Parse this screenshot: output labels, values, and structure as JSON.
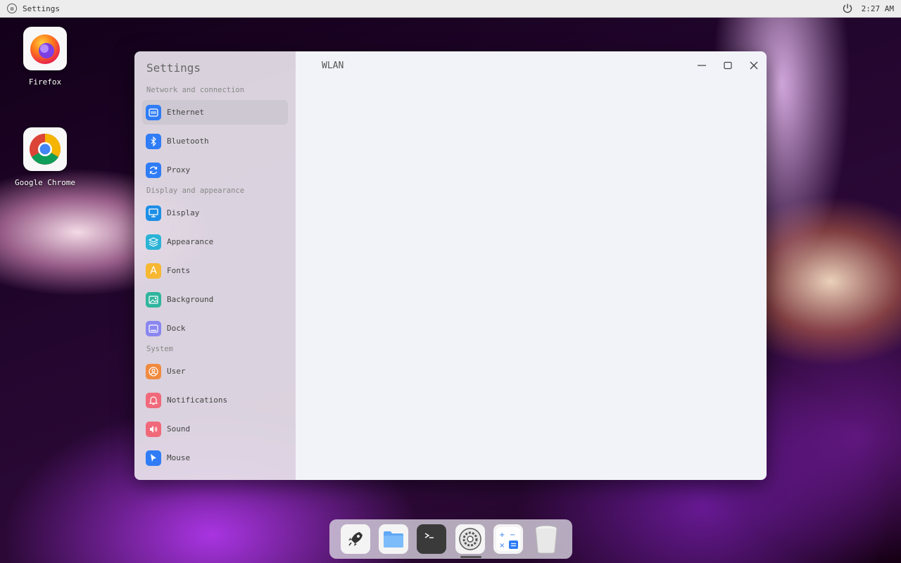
{
  "topbar": {
    "app_title": "Settings",
    "time": "2:27 AM"
  },
  "desktop": {
    "icons": [
      {
        "label": "Firefox",
        "icon": "firefox-icon"
      },
      {
        "label": "Google Chrome",
        "icon": "chrome-icon"
      }
    ]
  },
  "window": {
    "sidebar_title": "Settings",
    "page_title": "WLAN",
    "groups": [
      {
        "label": "Network and connection",
        "items": [
          {
            "label": "Ethernet",
            "icon": "ethernet-icon",
            "color": "#2f7cf6",
            "active": true
          },
          {
            "label": "Bluetooth",
            "icon": "bluetooth-icon",
            "color": "#2f7cf6"
          },
          {
            "label": "Proxy",
            "icon": "proxy-icon",
            "color": "#2f7cf6"
          }
        ]
      },
      {
        "label": "Display and appearance",
        "items": [
          {
            "label": "Display",
            "icon": "monitor-icon",
            "color": "#1e8fe6"
          },
          {
            "label": "Appearance",
            "icon": "layers-icon",
            "color": "#2bb3d6"
          },
          {
            "label": "Fonts",
            "icon": "font-icon",
            "color": "#f7b733"
          },
          {
            "label": "Background",
            "icon": "image-icon",
            "color": "#2fb59e"
          },
          {
            "label": "Dock",
            "icon": "dock-icon",
            "color": "#8a86f0"
          }
        ]
      },
      {
        "label": "System",
        "items": [
          {
            "label": "User",
            "icon": "user-icon",
            "color": "#f08a3e"
          },
          {
            "label": "Notifications",
            "icon": "bell-icon",
            "color": "#f0697a"
          },
          {
            "label": "Sound",
            "icon": "speaker-icon",
            "color": "#f0697a"
          },
          {
            "label": "Mouse",
            "icon": "cursor-icon",
            "color": "#2f7cf6"
          }
        ]
      }
    ]
  },
  "dock": {
    "items": [
      {
        "icon": "launcher-rocket-icon"
      },
      {
        "icon": "files-folder-icon"
      },
      {
        "icon": "terminal-icon"
      },
      {
        "icon": "settings-gear-icon",
        "active": true
      },
      {
        "icon": "calculator-icon"
      },
      {
        "icon": "trash-icon"
      }
    ]
  }
}
